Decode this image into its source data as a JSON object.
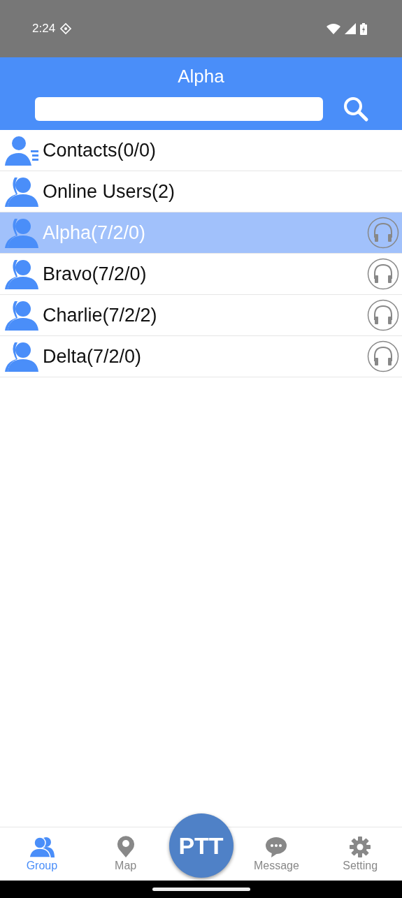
{
  "status_bar": {
    "time": "2:24"
  },
  "header": {
    "title": "Alpha"
  },
  "items": [
    {
      "kind": "contacts",
      "label": "Contacts(0/0)",
      "selected": false
    },
    {
      "kind": "online",
      "label": "Online Users(2)",
      "selected": false
    },
    {
      "kind": "group",
      "label": "Alpha(7/2/0)",
      "selected": true
    },
    {
      "kind": "group",
      "label": "Bravo(7/2/0)",
      "selected": false
    },
    {
      "kind": "group",
      "label": "Charlie(7/2/2)",
      "selected": false
    },
    {
      "kind": "group",
      "label": "Delta(7/2/0)",
      "selected": false
    }
  ],
  "ptt": "PTT",
  "tabs": [
    {
      "kind": "group",
      "label": "Group",
      "selected": true
    },
    {
      "kind": "map",
      "label": "Map",
      "selected": false
    },
    {
      "kind": "message",
      "label": "Message",
      "selected": false
    },
    {
      "kind": "setting",
      "label": "Setting",
      "selected": false
    }
  ]
}
